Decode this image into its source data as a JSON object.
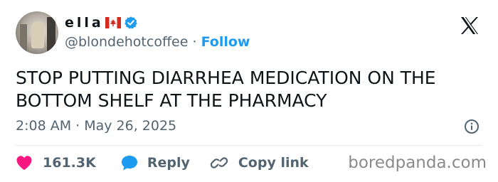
{
  "author": {
    "display_name": "ella",
    "flag_icon": "canada-flag-icon",
    "verified_icon": "verified-badge-icon",
    "handle": "@blondehotcoffee",
    "separator": "·",
    "follow_label": "Follow"
  },
  "tweet": {
    "text": "STOP PUTTING DIARRHEA MEDICATION ON THE BOTTOM SHELF AT THE PHARMACY",
    "timestamp": "2:08 AM · May 26, 2025"
  },
  "actions": {
    "like_count": "161.3K",
    "reply_label": "Reply",
    "copy_link_label": "Copy link"
  },
  "watermark": "boredpanda.com",
  "colors": {
    "accent": "#1d9bf0",
    "like": "#f91880",
    "text": "#0f1419",
    "muted": "#536471"
  }
}
